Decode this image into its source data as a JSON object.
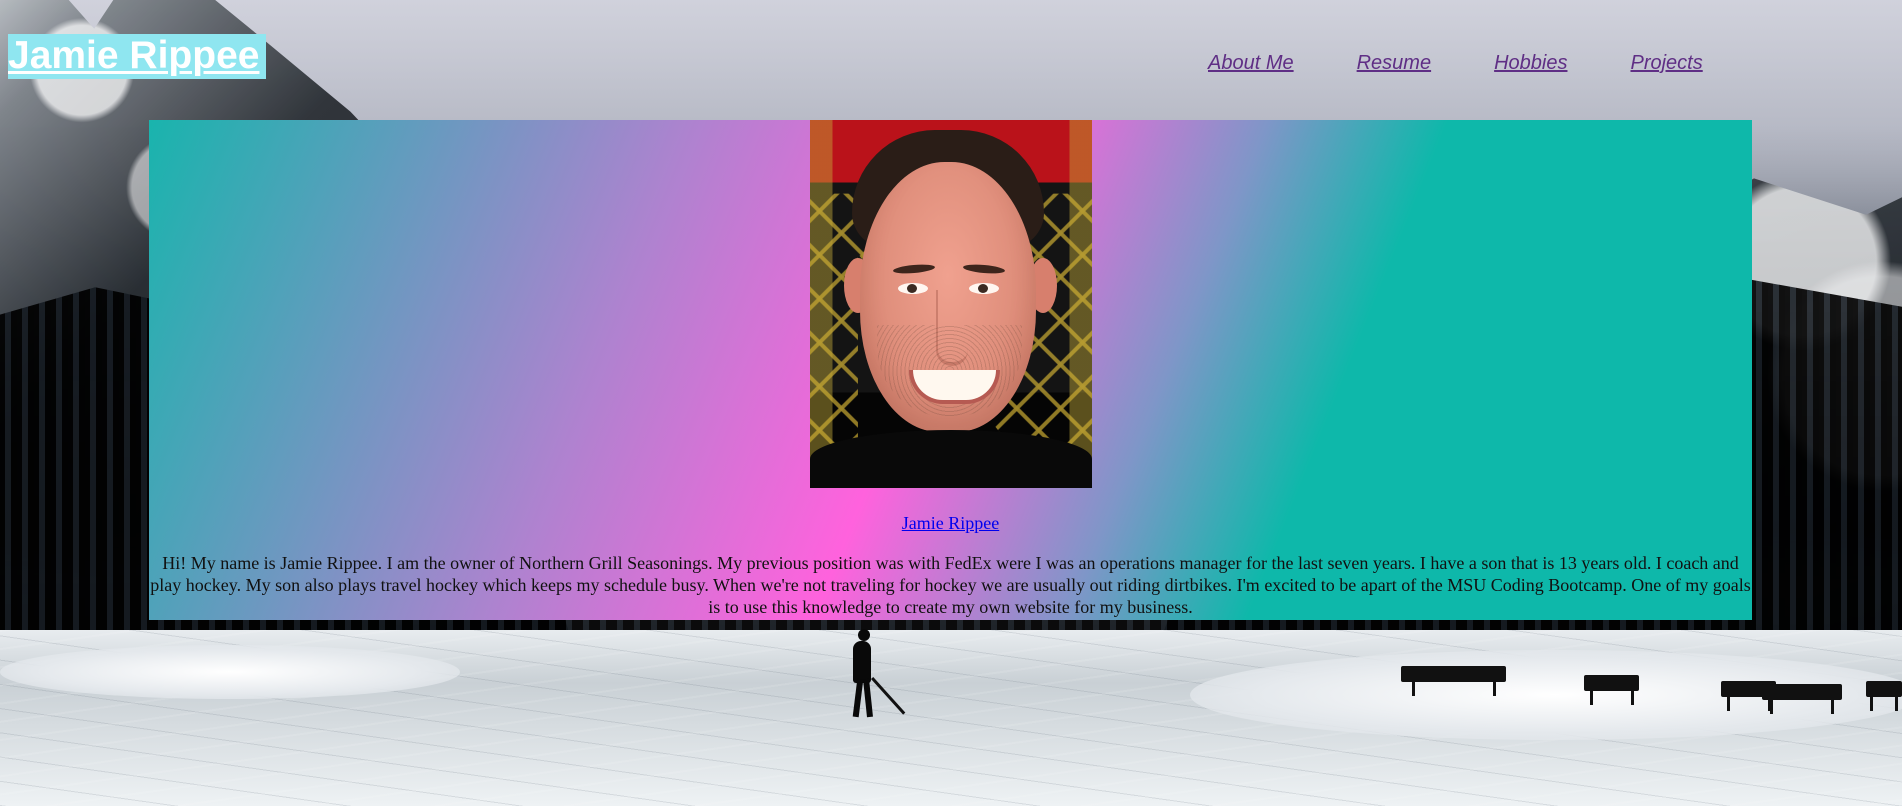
{
  "header": {
    "title": "Jamie Rippee"
  },
  "nav": {
    "items": [
      {
        "label": "About Me"
      },
      {
        "label": "Resume"
      },
      {
        "label": "Hobbies"
      },
      {
        "label": "Projects"
      }
    ]
  },
  "profile": {
    "name_link": "Jamie Rippee",
    "bio": "Hi! My name is Jamie Rippee. I am the owner of Northern Grill Seasonings. My previous position was with FedEx were I was an operations manager for the last seven years. I have a son that is 13 years old. I coach and play hockey. My son also plays travel hockey which keeps my schedule busy. When we're not traveling for hockey we are usually out riding dirtbikes. I'm excited to be apart of the MSU Coding Bootcamp. One of my goals is to use this knowledge to create my own website for my business."
  },
  "theme": {
    "title_background": "#8fe6f0",
    "nav_link_color": "#5f2e85",
    "panel_gradient_colors": [
      "#19b4ad",
      "#ad83cf",
      "#ff62dd",
      "#0eb8aa"
    ],
    "profile_link_color": "#0000ee"
  },
  "icons": {
    "background_image": "winter-hockey-rink-icon",
    "profile_photo": "portrait-photo-icon"
  }
}
